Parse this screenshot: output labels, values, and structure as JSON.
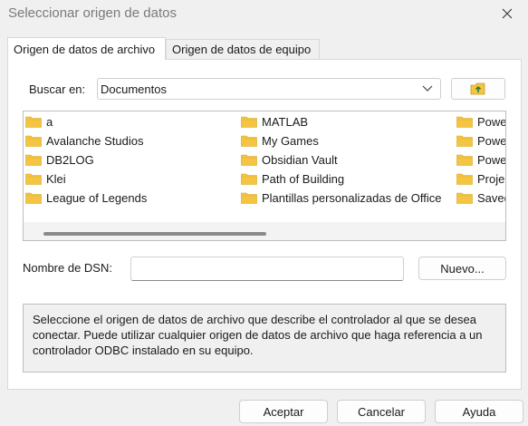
{
  "window": {
    "title": "Seleccionar origen de datos"
  },
  "tabs": [
    {
      "label": "Origen de datos de archivo",
      "active": true
    },
    {
      "label": "Origen de datos de equipo",
      "active": false
    }
  ],
  "lookin": {
    "label": "Buscar en:",
    "value": "Documentos"
  },
  "files": {
    "col1": [
      "a",
      "Avalanche Studios",
      "DB2LOG",
      "Klei",
      "League of Legends"
    ],
    "col2": [
      "MATLAB",
      "My Games",
      "Obsidian Vault",
      "Path of Building",
      "Plantillas personalizadas de Office"
    ],
    "col3": [
      "Powe",
      "Powe",
      "Powe",
      "Proje",
      "Saved"
    ]
  },
  "dsn": {
    "label": "Nombre de DSN:",
    "value": "",
    "new_button": "Nuevo..."
  },
  "description": "Seleccione el origen de datos de archivo que describe el controlador al que se desea conectar. Puede utilizar cualquier origen de datos de archivo que haga referencia a un controlador ODBC instalado en su equipo.",
  "buttons": {
    "accept": "Aceptar",
    "cancel": "Cancelar",
    "help": "Ayuda"
  },
  "colors": {
    "folder": "#f4c542",
    "background": "#f0f0f0"
  }
}
